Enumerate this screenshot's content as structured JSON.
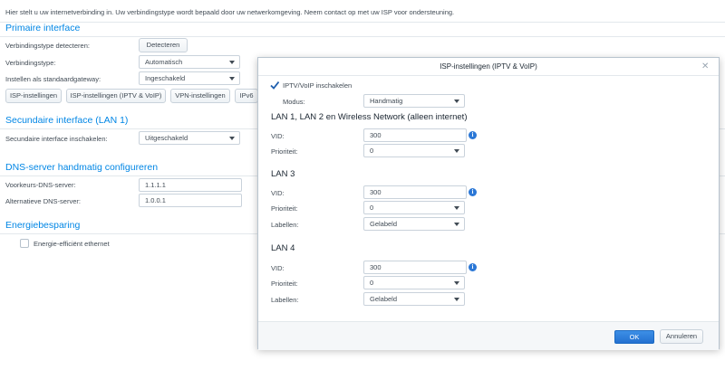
{
  "intro_text": "Hier stelt u uw internetverbinding in. Uw verbindingstype wordt bepaald door uw netwerkomgeving. Neem contact op met uw ISP voor ondersteuning.",
  "primary": {
    "title": "Primaire interface",
    "detect_label": "Verbindingstype detecteren:",
    "detect_button": "Detecteren",
    "type_label": "Verbindingstype:",
    "type_value": "Automatisch",
    "gateway_label": "Instellen als standaardgateway:",
    "gateway_value": "Ingeschakeld",
    "buttons": [
      "ISP-instellingen",
      "ISP-instellingen (IPTV & VoIP)",
      "VPN-instellingen",
      "IPv6"
    ]
  },
  "secondary": {
    "title": "Secundaire interface (LAN 1)",
    "enable_label": "Secundaire interface inschakelen:",
    "enable_value": "Uitgeschakeld"
  },
  "dns": {
    "title": "DNS-server handmatig configureren",
    "preferred_label": "Voorkeurs-DNS-server:",
    "preferred_value": "1.1.1.1",
    "alternate_label": "Alternatieve DNS-server:",
    "alternate_value": "1.0.0.1"
  },
  "energy": {
    "title": "Energiebesparing",
    "eee_label": "Energie-efficiënt ethernet"
  },
  "modal": {
    "title": "ISP-instellingen (IPTV & VoIP)",
    "enable_label": "IPTV/VoIP inschakelen",
    "mode_label": "Modus:",
    "mode_value": "Handmatig",
    "lan12": {
      "title": "LAN 1, LAN 2 en Wireless Network (alleen internet)",
      "vid_label": "VID:",
      "vid_value": "300",
      "prio_label": "Prioriteit:",
      "prio_value": "0"
    },
    "lan3": {
      "title": "LAN 3",
      "vid_label": "VID:",
      "vid_value": "300",
      "prio_label": "Prioriteit:",
      "prio_value": "0",
      "tag_label": "Labellen:",
      "tag_value": "Gelabeld"
    },
    "lan4": {
      "title": "LAN 4",
      "vid_label": "VID:",
      "vid_value": "300",
      "prio_label": "Prioriteit:",
      "prio_value": "0",
      "tag_label": "Labellen:",
      "tag_value": "Gelabeld"
    },
    "ok_button": "OK",
    "cancel_button": "Annuleren",
    "info_icon_glyph": "i"
  },
  "colors": {
    "accent": "#0086e5",
    "primary_button": "#2471d1",
    "info_icon": "#2a77d6"
  }
}
